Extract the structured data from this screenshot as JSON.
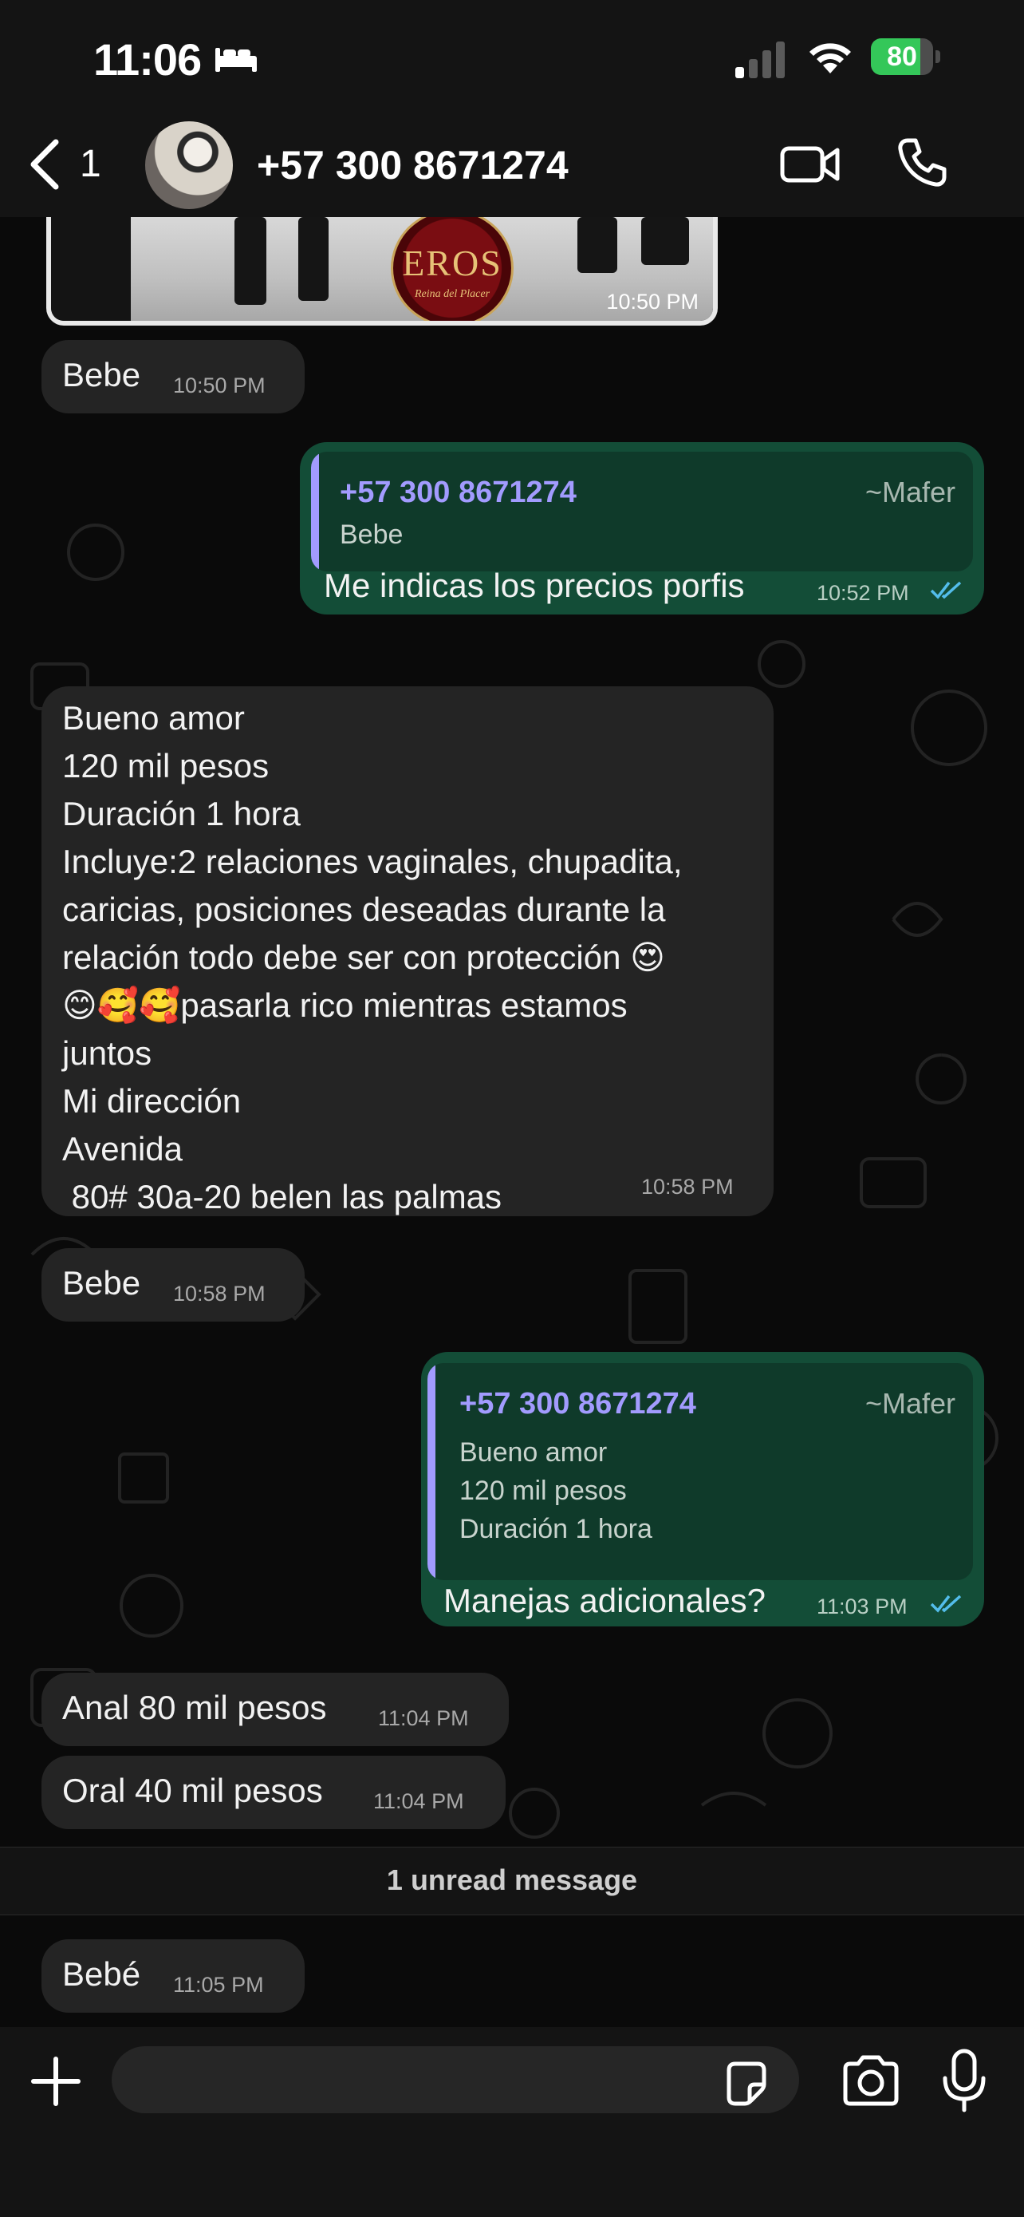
{
  "status_bar": {
    "time": "11:06",
    "battery": "80",
    "battery_level": 0.8,
    "battery_color": "#34c759"
  },
  "header": {
    "back_count": "1",
    "contact_name": "+57 300 8671274"
  },
  "media_message": {
    "logo_text": "EROS",
    "logo_subtitle": "Reina del Placer",
    "time": "10:50 PM"
  },
  "messages": [
    {
      "type": "incoming",
      "text": "Bebe",
      "time": "10:50 PM"
    },
    {
      "type": "outgoing",
      "quote_name": "+57 300 8671274",
      "quote_alias": "~Mafer",
      "quote_text": "Bebe",
      "text": "Me indicas los precios porfis",
      "time": "10:52 PM"
    },
    {
      "type": "incoming",
      "text": "Bueno amor\n120 mil pesos\nDuración 1 hora\nIncluye:2 relaciones vaginales, chupadita,\ncaricias, posiciones deseadas durante la\nrelación todo debe ser con protección 😍\n😊🥰🥰pasarla rico mientras estamos\njuntos\nMi dirección\nAvenida\n 80# 30a-20 belen las palmas",
      "time": "10:58 PM"
    },
    {
      "type": "incoming",
      "text": "Bebe",
      "time": "10:58 PM"
    },
    {
      "type": "outgoing",
      "quote_name": "+57 300 8671274",
      "quote_alias": "~Mafer",
      "quote_text": "Bueno amor\n120 mil pesos\nDuración 1 hora",
      "text": "Manejas adicionales?",
      "time": "11:03 PM"
    },
    {
      "type": "incoming",
      "text": "Anal 80 mil pesos",
      "time": "11:04 PM"
    },
    {
      "type": "incoming",
      "text": "Oral 40 mil pesos",
      "time": "11:04 PM"
    },
    {
      "type": "incoming",
      "text": "Bebé",
      "time": "11:05 PM"
    }
  ],
  "unread_banner": "1 unread message",
  "input": {
    "placeholder": ""
  },
  "colors": {
    "incoming_bubble": "#242424",
    "outgoing_bubble": "#134d37",
    "quote_accent": "#a29bfe",
    "read_ticks": "#53bdeb"
  }
}
